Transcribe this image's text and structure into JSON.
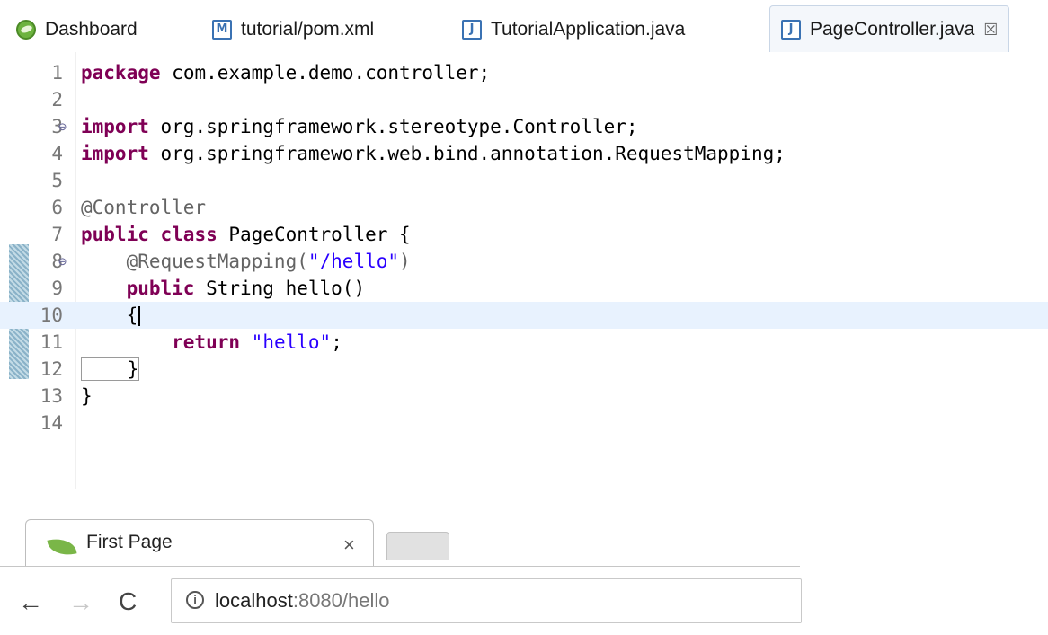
{
  "ide": {
    "tabs": [
      {
        "label": "Dashboard",
        "icon": "spring-dashboard-icon"
      },
      {
        "label": "tutorial/pom.xml",
        "icon": "maven-file-icon",
        "badge": "M"
      },
      {
        "label": "TutorialApplication.java",
        "icon": "java-file-icon",
        "badge": "J"
      },
      {
        "label": "PageController.java",
        "icon": "java-file-icon",
        "badge": "J",
        "active": true,
        "close": "☒"
      }
    ],
    "lines": [
      {
        "n": "1",
        "parts": [
          [
            "kw",
            "package"
          ],
          [
            "",
            "com.example.demo.controller;"
          ]
        ]
      },
      {
        "n": "2",
        "parts": []
      },
      {
        "n": "3",
        "fold": "⊖",
        "parts": [
          [
            "kw",
            "import"
          ],
          [
            "",
            "org.springframework.stereotype.Controller;"
          ]
        ]
      },
      {
        "n": "4",
        "parts": [
          [
            "kw",
            "import"
          ],
          [
            "",
            "org.springframework.web.bind.annotation.RequestMapping;"
          ]
        ]
      },
      {
        "n": "5",
        "parts": []
      },
      {
        "n": "6",
        "parts": [
          [
            "ann",
            "@Controller"
          ]
        ]
      },
      {
        "n": "7",
        "parts": [
          [
            "kw",
            "public"
          ],
          [
            "kw",
            "class"
          ],
          [
            "",
            "PageController {"
          ]
        ]
      },
      {
        "n": "8",
        "fold": "⊖",
        "parts": [
          [
            "ann",
            "    @RequestMapping("
          ],
          [
            "str",
            "\"/hello\""
          ],
          [
            "ann",
            ")"
          ]
        ]
      },
      {
        "n": "9",
        "parts": [
          [
            "kw",
            "    public"
          ],
          [
            "",
            "String hello()"
          ]
        ]
      },
      {
        "n": "10",
        "current": true,
        "caret": true,
        "parts": [
          [
            "",
            "    {"
          ]
        ]
      },
      {
        "n": "11",
        "parts": [
          [
            "kw",
            "        return"
          ],
          [
            "str",
            "\"hello\""
          ],
          [
            "",
            ";"
          ]
        ]
      },
      {
        "n": "12",
        "box": true,
        "parts": [
          [
            "",
            "    }"
          ]
        ]
      },
      {
        "n": "13",
        "parts": [
          [
            "",
            "}"
          ]
        ]
      },
      {
        "n": "14",
        "parts": []
      }
    ]
  },
  "browser": {
    "tab_title": "First Page",
    "tab_close": "×",
    "back": "←",
    "forward": "→",
    "reload": "C",
    "info": "i",
    "url_host": "localhost",
    "url_rest": ":8080/hello"
  }
}
